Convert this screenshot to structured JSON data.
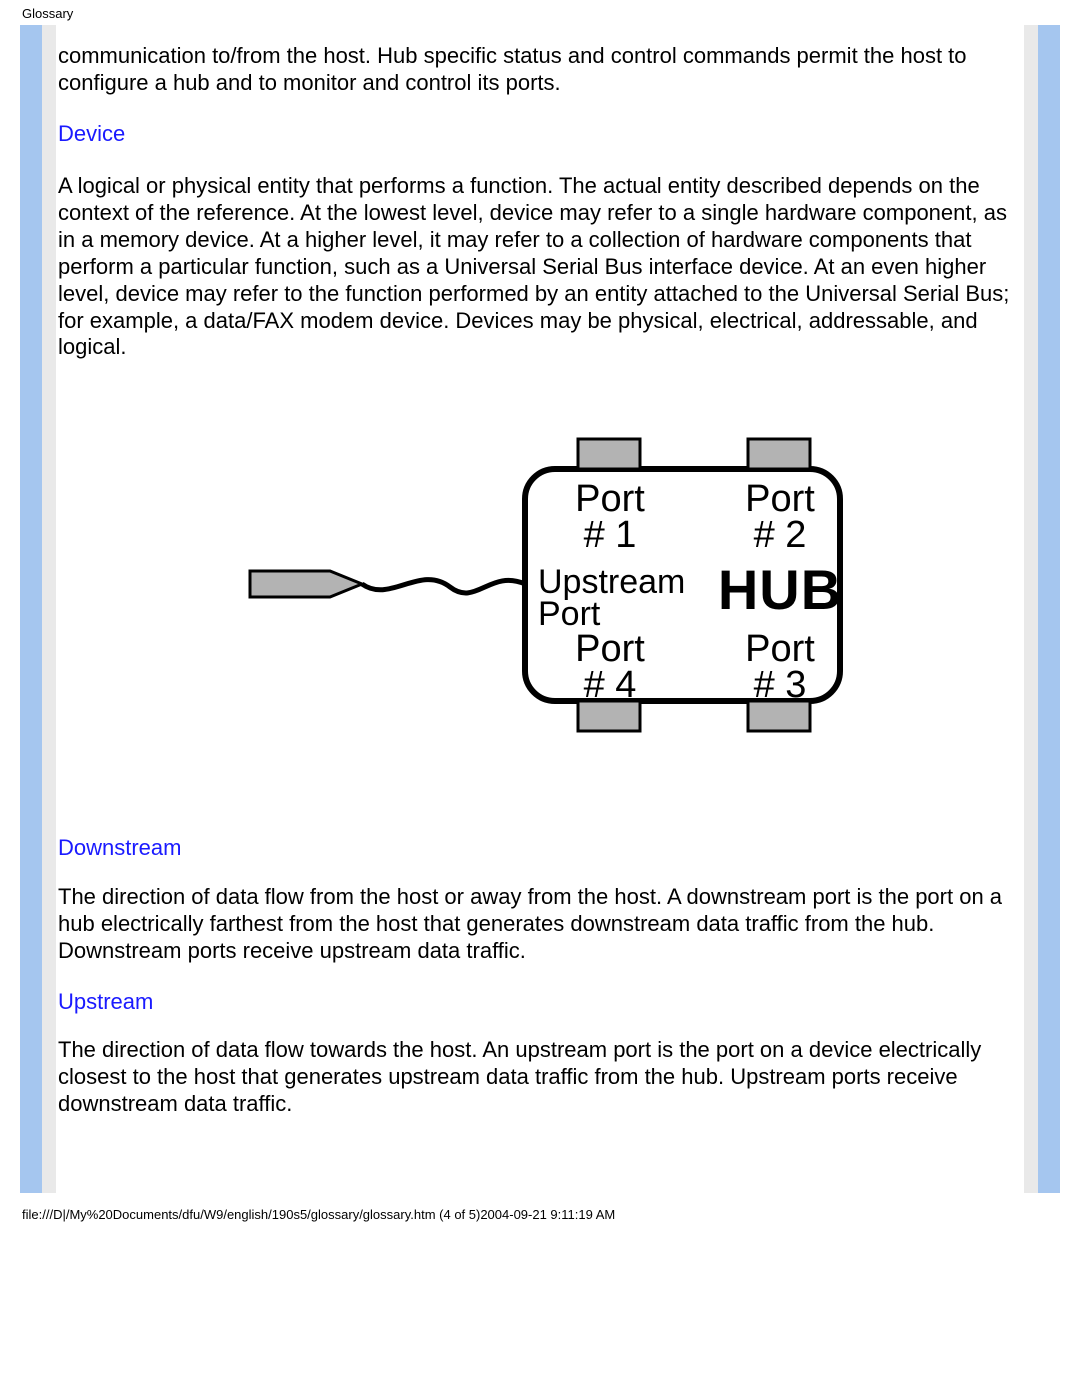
{
  "header": {
    "label": "Glossary"
  },
  "intro_paragraph": "communication to/from the host. Hub specific status and control commands permit the host to configure a hub and to monitor and control its ports.",
  "sections": {
    "device": {
      "heading": "Device",
      "body": "A logical or physical entity that performs a function. The actual entity described depends on the context of the reference. At the lowest level, device may refer to a single hardware component, as in a memory device. At a higher level, it may refer to a collection of hardware components that perform a particular function, such as a Universal Serial Bus interface device. At an even higher level, device may refer to the function performed by an entity attached to the Universal Serial Bus; for example, a data/FAX modem device. Devices may be physical, electrical, addressable, and logical."
    },
    "downstream": {
      "heading": "Downstream",
      "body": "The direction of data flow from the host or away from the host. A downstream port is the port on a hub electrically farthest from the host that generates downstream data traffic from the hub. Downstream ports receive upstream data traffic."
    },
    "upstream": {
      "heading": "Upstream",
      "body": "The direction of data flow towards the host. An upstream port is the port on a device electrically closest to the host that generates upstream data traffic from the hub. Upstream ports receive downstream data traffic."
    }
  },
  "diagram": {
    "port1_l1": "Port",
    "port1_l2": "# 1",
    "port2_l1": "Port",
    "port2_l2": "# 2",
    "port3_l1": "Port",
    "port3_l2": "# 3",
    "port4_l1": "Port",
    "port4_l2": "# 4",
    "upstream_l1": "Upstream",
    "upstream_l2": "Port",
    "hub": "HUB"
  },
  "footer": {
    "path": "file:///D|/My%20Documents/dfu/W9/english/190s5/glossary/glossary.htm (4 of 5)2004-09-21 9:11:19 AM"
  }
}
